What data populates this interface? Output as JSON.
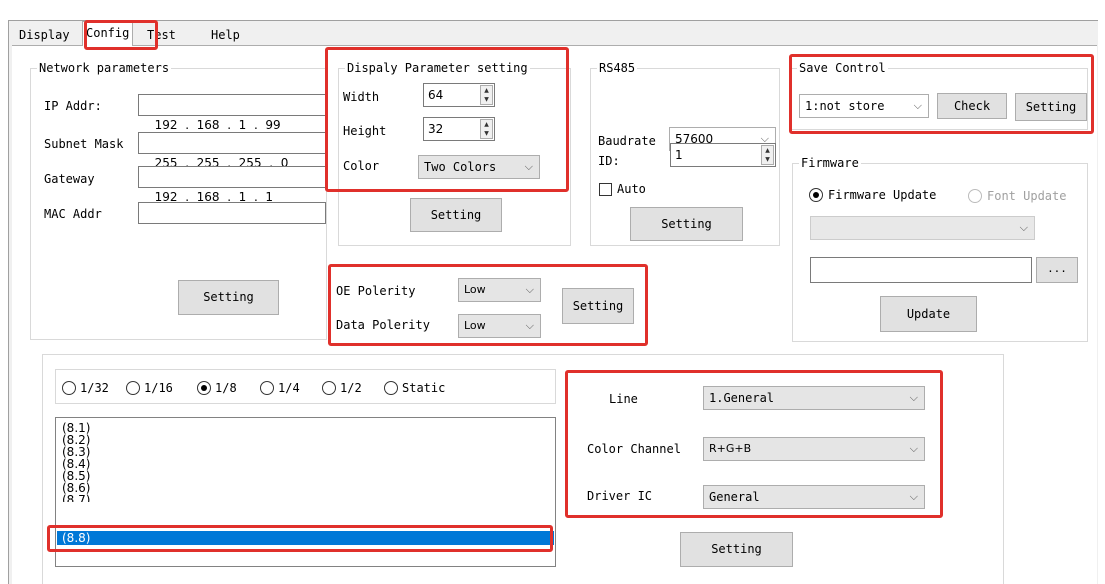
{
  "tabs": {
    "display": "Display",
    "config": "Config",
    "test": "Test",
    "help": "Help"
  },
  "network": {
    "title": "Network parameters",
    "ip_label": "IP Addr:",
    "ip": [
      "192",
      ".",
      "168",
      ".",
      "1",
      ".",
      "99"
    ],
    "mask_label": "Subnet Mask",
    "mask": [
      "255",
      ".",
      "255",
      ".",
      "255",
      ".",
      "0"
    ],
    "gw_label": "Gateway",
    "gw": [
      "192",
      ".",
      "168",
      ".",
      "1",
      ".",
      "1"
    ],
    "mac_label": "MAC Addr",
    "mac_value": "",
    "setting": "Setting"
  },
  "display_param": {
    "title": "Dispaly Parameter setting",
    "width_label": "Width",
    "width_value": "64",
    "height_label": "Height",
    "height_value": "32",
    "color_label": "Color",
    "color_value": "Two Colors",
    "setting": "Setting"
  },
  "rs485": {
    "title": "RS485",
    "baud_label": "Baudrate",
    "baud_value": "57600",
    "id_label": "ID:",
    "id_value": "1",
    "auto_label": "Auto",
    "setting": "Setting"
  },
  "save_control": {
    "title": "Save Control",
    "value": "1:not store",
    "check": "Check",
    "setting": "Setting"
  },
  "firmware": {
    "title": "Firmware",
    "firmware_update": "Firmware Update",
    "font_update": "Font Update",
    "browse": "...",
    "update": "Update"
  },
  "polarity": {
    "oe_label": "OE Polerity",
    "oe_value": "Low",
    "data_label": "Data Polerity",
    "data_value": "Low",
    "setting": "Setting"
  },
  "scan": {
    "options": [
      "1/32",
      "1/16",
      "1/8",
      "1/4",
      "1/2",
      "Static"
    ],
    "selected": "1/8",
    "items": [
      "(8.1)",
      "(8.2)",
      "(8.3)",
      "(8.4)",
      "(8.5)",
      "(8.6)",
      "(8.7)",
      "(8.8)"
    ],
    "selected_item": "(8.8)"
  },
  "driver": {
    "line_label": "Line",
    "line_value": "1.General",
    "channel_label": "Color Channel",
    "channel_value": "R+G+B",
    "ic_label": "Driver IC",
    "ic_value": "General",
    "setting": "Setting"
  },
  "colors": {
    "highlight": "#e0302b",
    "selection": "#0078d7"
  },
  "icons": {
    "dropdown": "chevron-down-icon",
    "spinner": "spin-arrows-icon"
  }
}
